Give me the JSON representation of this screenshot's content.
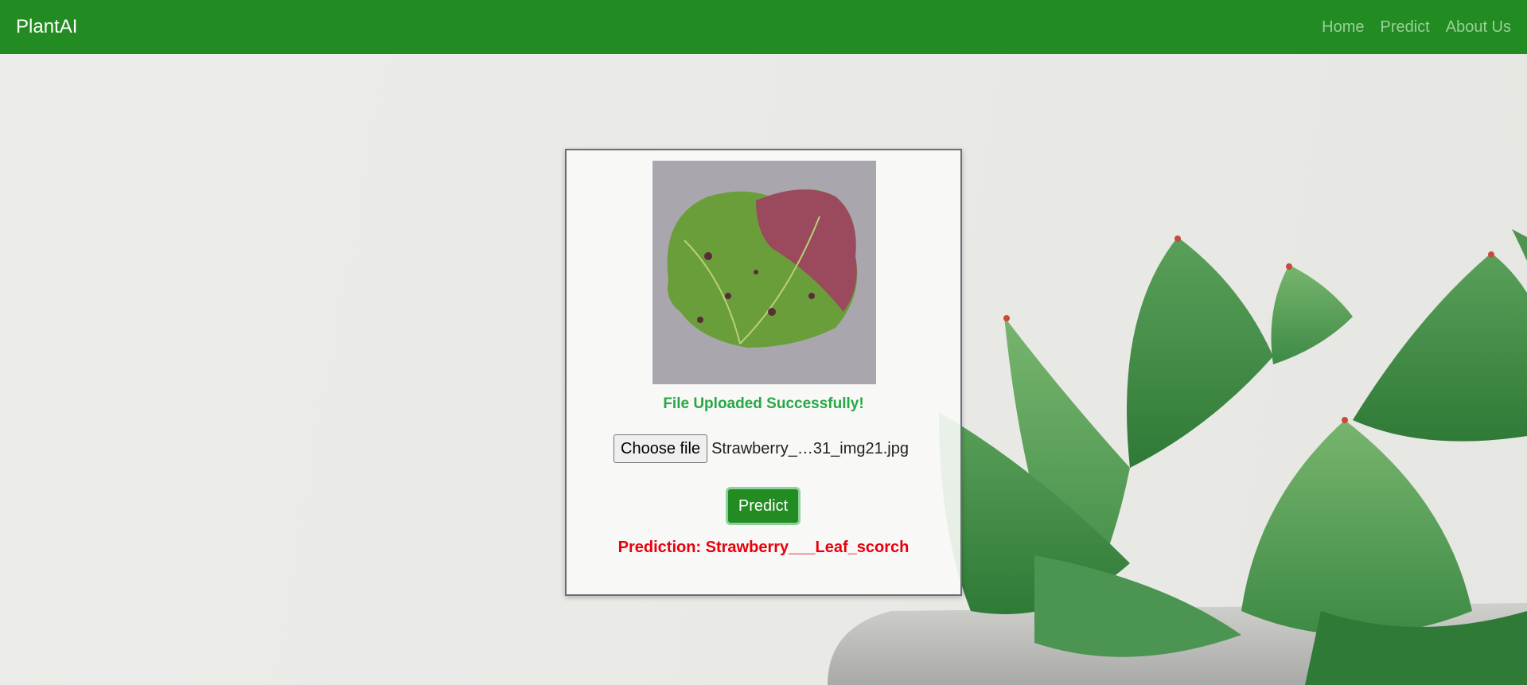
{
  "navbar": {
    "brand": "PlantAI",
    "links": [
      {
        "label": "Home"
      },
      {
        "label": "Predict"
      },
      {
        "label": "About Us"
      }
    ],
    "color": "#228b22"
  },
  "upload": {
    "status": "File Uploaded Successfully!",
    "choose_label": "Choose file",
    "file_name": "Strawberry_…31_img21.jpg",
    "predict_label": "Predict",
    "prediction": "Prediction: Strawberry___Leaf_scorch"
  },
  "icons": [
    "leaf-preview-image",
    "succulent-background"
  ],
  "colors": {
    "success": "#28a745",
    "error": "#e8000b",
    "accent": "#228b22"
  }
}
